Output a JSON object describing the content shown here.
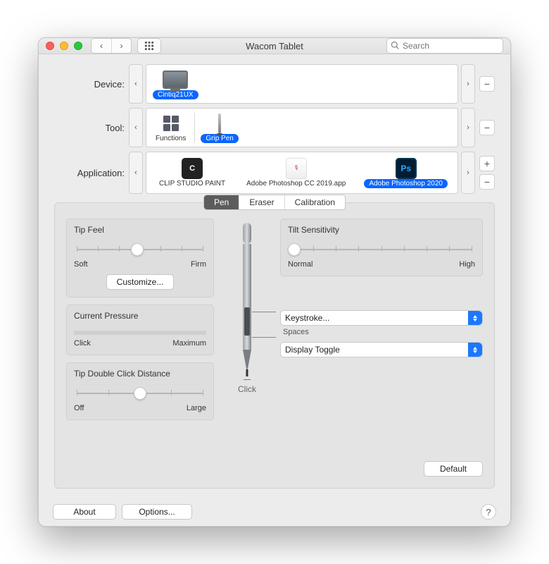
{
  "window": {
    "title": "Wacom Tablet"
  },
  "toolbar": {
    "search_placeholder": "Search"
  },
  "rows": {
    "device": {
      "label": "Device:",
      "items": [
        {
          "label": "Cintiq21UX",
          "selected": true
        }
      ]
    },
    "tool": {
      "label": "Tool:",
      "items": [
        {
          "label": "Functions",
          "selected": false
        },
        {
          "label": "Grip Pen",
          "selected": true
        }
      ]
    },
    "application": {
      "label": "Application:",
      "items": [
        {
          "label": "CLIP STUDIO PAINT",
          "selected": false
        },
        {
          "label": "Adobe Photoshop CC 2019.app",
          "selected": false
        },
        {
          "label": "Adobe Photoshop 2020",
          "selected": true
        }
      ]
    }
  },
  "tabs": {
    "pen": "Pen",
    "eraser": "Eraser",
    "calibration": "Calibration",
    "active": "pen"
  },
  "panel": {
    "tip_feel": {
      "title": "Tip Feel",
      "min": "Soft",
      "max": "Firm",
      "customize": "Customize..."
    },
    "pressure": {
      "title": "Current Pressure",
      "min": "Click",
      "max": "Maximum"
    },
    "dbl": {
      "title": "Tip Double Click Distance",
      "min": "Off",
      "max": "Large"
    },
    "tilt": {
      "title": "Tilt Sensitivity",
      "min": "Normal",
      "max": "High"
    },
    "button1": {
      "value": "Keystroke...",
      "sub": "Spaces"
    },
    "button2": {
      "value": "Display Toggle"
    },
    "click_label": "Click",
    "default_btn": "Default"
  },
  "footer": {
    "about": "About",
    "options": "Options...",
    "help": "?"
  },
  "glyph": {
    "minus": "−",
    "plus": "+",
    "left": "‹",
    "right": "›"
  }
}
